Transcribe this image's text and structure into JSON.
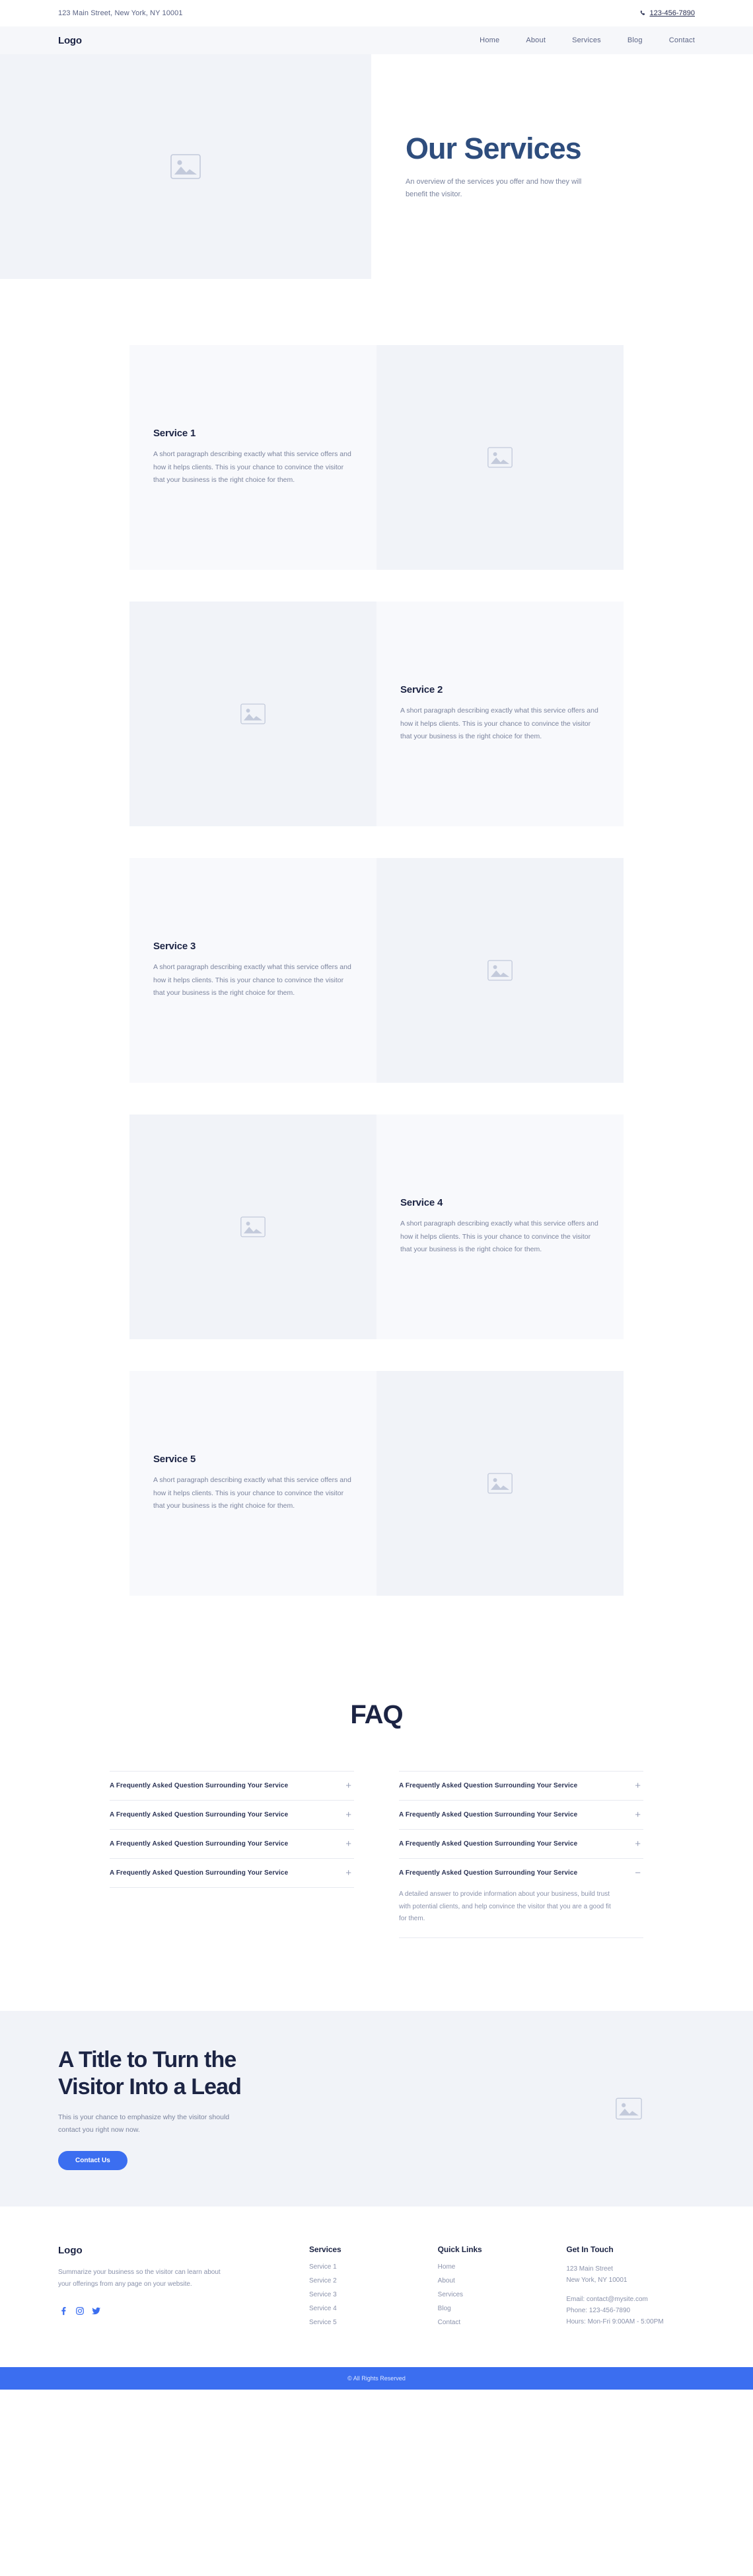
{
  "topbar": {
    "address": "123 Main Street, New York, NY 10001",
    "phone": "123-456-7890",
    "phone_icon": "phone-icon"
  },
  "nav": {
    "brand": "Logo",
    "links": [
      {
        "label": "Home"
      },
      {
        "label": "About"
      },
      {
        "label": "Services"
      },
      {
        "label": "Blog"
      },
      {
        "label": "Contact"
      }
    ]
  },
  "hero": {
    "title": "Our Services",
    "subtitle": "An overview of the services you offer and how they will benefit the visitor.",
    "image_icon": "image-placeholder-icon"
  },
  "services": [
    {
      "title": "Service 1",
      "body": "A short paragraph describing exactly what this service offers and how it helps clients. This is your chance to convince the visitor that your business is the right choice for them.",
      "image_side": "right"
    },
    {
      "title": "Service 2",
      "body": "A short paragraph describing exactly what this service offers and how it helps clients. This is your chance to convince the visitor that your business is the right choice for them.",
      "image_side": "left"
    },
    {
      "title": "Service 3",
      "body": "A short paragraph describing exactly what this service offers and how it helps clients. This is your chance to convince the visitor that your business is the right choice for them.",
      "image_side": "right"
    },
    {
      "title": "Service 4",
      "body": "A short paragraph describing exactly what this service offers and how it helps clients. This is your chance to convince the visitor that your business is the right choice for them.",
      "image_side": "left"
    },
    {
      "title": "Service 5",
      "body": "A short paragraph describing exactly what this service offers and how it helps clients. This is your chance to convince the visitor that your business is the right choice for them.",
      "image_side": "right"
    }
  ],
  "faq": {
    "title": "FAQ",
    "expand_sign": "+",
    "collapse_sign": "−",
    "left": [
      {
        "question": "A Frequently Asked Question Surrounding Your Service",
        "expanded": false
      },
      {
        "question": "A Frequently Asked Question Surrounding Your Service",
        "expanded": false
      },
      {
        "question": "A Frequently Asked Question Surrounding Your Service",
        "expanded": false
      },
      {
        "question": "A Frequently Asked Question Surrounding Your Service",
        "expanded": false
      }
    ],
    "right": [
      {
        "question": "A Frequently Asked Question Surrounding Your Service",
        "expanded": false
      },
      {
        "question": "A Frequently Asked Question Surrounding Your Service",
        "expanded": false
      },
      {
        "question": "A Frequently Asked Question Surrounding Your Service",
        "expanded": false
      },
      {
        "question": "A Frequently Asked Question Surrounding Your Service",
        "expanded": true,
        "answer": "A detailed answer to provide information about your business, build trust with potential clients, and help convince the visitor that you are a good fit for them."
      }
    ]
  },
  "cta": {
    "title_line1": "A Title to Turn the",
    "title_line2": "Visitor Into a Lead",
    "subtitle": "This is your chance to emphasize why the visitor should contact you right now now.",
    "button_label": "Contact Us",
    "button_color": "#3b6ef0",
    "image_icon": "image-placeholder-icon"
  },
  "footer": {
    "logo": "Logo",
    "about": "Summarize your business so the visitor can learn about your offerings from any page on your website.",
    "social": [
      {
        "name": "facebook-icon",
        "glyph": "f",
        "color": "#3b6ef0"
      },
      {
        "name": "instagram-icon",
        "glyph": "▣",
        "color": "#3b6ef0"
      },
      {
        "name": "twitter-icon",
        "glyph": "✈",
        "color": "#3b6ef0"
      }
    ],
    "services": {
      "heading": "Services",
      "items": [
        {
          "label": "Service 1"
        },
        {
          "label": "Service 2"
        },
        {
          "label": "Service 3"
        },
        {
          "label": "Service 4"
        },
        {
          "label": "Service 5"
        }
      ]
    },
    "quick_links": {
      "heading": "Quick Links",
      "items": [
        {
          "label": "Home"
        },
        {
          "label": "About"
        },
        {
          "label": "Services"
        },
        {
          "label": "Blog"
        },
        {
          "label": "Contact"
        }
      ]
    },
    "contact": {
      "heading": "Get In Touch",
      "address_line1": "123 Main Street",
      "address_line2": "New York, NY 10001",
      "email": "Email: contact@mysite.com",
      "phone": "Phone: 123-456-7890",
      "hours": "Hours: Mon-Fri 9:00AM - 5:00PM"
    }
  },
  "copyright": {
    "text": "© All Rights Reserved"
  }
}
